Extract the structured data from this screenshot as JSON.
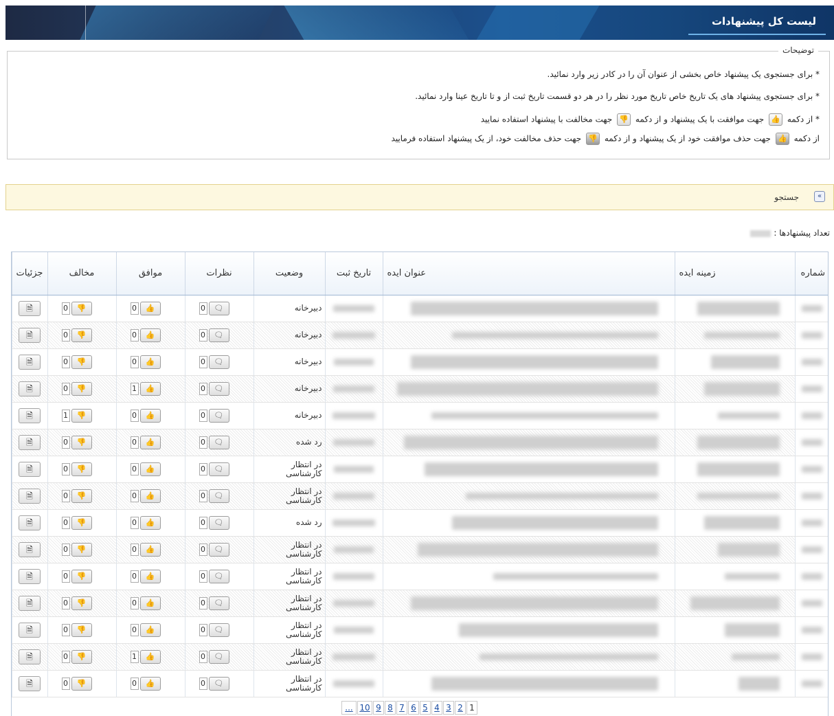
{
  "header": {
    "title": "لیست کل پیشنهادات"
  },
  "description": {
    "legend": "توضیحات",
    "line1": "* برای جستجوی یک پیشنهاد خاص بخشی از عنوان آن را در کادر زیر وارد نمائید.",
    "line2": "* برای جستجوی پیشنهاد های یک تاریخ خاص تاریخ مورد نظر را در هر دو قسمت تاریخ ثبت از و تا تاریخ عینا وارد نمائید.",
    "line3_a": "* از دکمه",
    "line3_b": "جهت  موافقت با یک پیشنهاد و از دکمه",
    "line3_c": "جهت  مخالفت با پیشنهاد استفاده نمایید",
    "line4_a": "از دکمه",
    "line4_b": "جهت  حذف موافقت خود از یک پیشنهاد و از دکمه",
    "line4_c": "جهت  حذف مخالفت خود، از یک پیشنهاد استفاده فرمایید"
  },
  "search": {
    "label": "جستجو",
    "expand_icon": "expand-icon"
  },
  "count": {
    "label": "تعداد پیشنهادها :"
  },
  "table": {
    "headers": {
      "number": "شماره",
      "field": "زمینه ایده",
      "title": "عنوان ایده",
      "date": "تاریخ ثبت",
      "status": "وضعیت",
      "comments": "نظرات",
      "agree": "موافق",
      "disagree": "مخالف",
      "details": "جزئیات"
    },
    "rows": [
      {
        "status": "دبیرخانه",
        "comments": "0",
        "agree": "0",
        "disagree": "0"
      },
      {
        "status": "دبیرخانه",
        "comments": "0",
        "agree": "0",
        "disagree": "0"
      },
      {
        "status": "دبیرخانه",
        "comments": "0",
        "agree": "0",
        "disagree": "0"
      },
      {
        "status": "دبیرخانه",
        "comments": "0",
        "agree": "1",
        "disagree": "0"
      },
      {
        "status": "دبیرخانه",
        "comments": "0",
        "agree": "0",
        "disagree": "1"
      },
      {
        "status": "رد شده",
        "comments": "0",
        "agree": "0",
        "disagree": "0"
      },
      {
        "status": "در انتظار کارشناسی",
        "comments": "0",
        "agree": "0",
        "disagree": "0"
      },
      {
        "status": "در انتظار کارشناسی",
        "comments": "0",
        "agree": "0",
        "disagree": "0"
      },
      {
        "status": "رد شده",
        "comments": "0",
        "agree": "0",
        "disagree": "0"
      },
      {
        "status": "در انتظار کارشناسی",
        "comments": "0",
        "agree": "0",
        "disagree": "0"
      },
      {
        "status": "در انتظار کارشناسی",
        "comments": "0",
        "agree": "0",
        "disagree": "0"
      },
      {
        "status": "در انتظار کارشناسی",
        "comments": "0",
        "agree": "0",
        "disagree": "0"
      },
      {
        "status": "در انتظار کارشناسی",
        "comments": "0",
        "agree": "0",
        "disagree": "0"
      },
      {
        "status": "در انتظار کارشناسی",
        "comments": "0",
        "agree": "1",
        "disagree": "0"
      },
      {
        "status": "در انتظار کارشناسی",
        "comments": "0",
        "agree": "0",
        "disagree": "0"
      }
    ]
  },
  "pager": {
    "pages": [
      "...",
      "10",
      "9",
      "8",
      "7",
      "6",
      "5",
      "4",
      "3",
      "2",
      "1"
    ],
    "current": "1"
  },
  "icons": {
    "agree": "thumbs-up-icon",
    "disagree": "thumbs-down-icon",
    "comment": "comment-icon",
    "details": "document-icon"
  },
  "colors": {
    "header_bg": "#1b4f8c",
    "search_bg": "#fdf8e0",
    "link": "#1d4fa3"
  }
}
